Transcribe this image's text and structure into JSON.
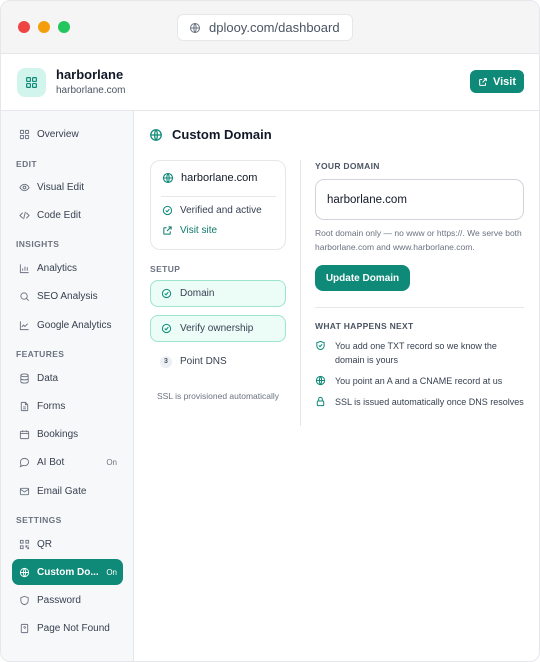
{
  "browser": {
    "url": "dplooy.com/dashboard"
  },
  "site": {
    "name": "harborlane",
    "domain": "harborlane.com",
    "visit_label": "Visit"
  },
  "sidebar": {
    "overview": "Overview",
    "sections": {
      "edit": "EDIT",
      "insights": "INSIGHTS",
      "features": "FEATURES",
      "settings": "SETTINGS"
    },
    "items": {
      "visual_edit": "Visual Edit",
      "code_edit": "Code Edit",
      "analytics": "Analytics",
      "seo_analysis": "SEO Analysis",
      "google_analytics": "Google Analytics",
      "data": "Data",
      "forms": "Forms",
      "bookings": "Bookings",
      "ai_bot": "AI Bot",
      "ai_bot_tag": "On",
      "email_gate": "Email Gate",
      "qr": "QR",
      "custom_domain": "Custom Do...",
      "custom_domain_tag": "On",
      "password": "Password",
      "page_not_found": "Page Not Found"
    }
  },
  "main": {
    "title": "Custom Domain",
    "card": {
      "domain": "harborlane.com",
      "status": "Verified and active",
      "visit_link": "Visit site"
    },
    "setup": {
      "label": "SETUP",
      "steps": [
        {
          "label": "Domain",
          "state": "done"
        },
        {
          "label": "Verify ownership",
          "state": "done"
        },
        {
          "label": "Point DNS",
          "state": "pending",
          "number": "3"
        }
      ],
      "ssl_note": "SSL is provisioned automatically"
    },
    "your_domain": {
      "label": "YOUR DOMAIN",
      "value": "harborlane.com",
      "hint": "Root domain only — no www or https://. We serve both harborlane.com and www.harborlane.com.",
      "button": "Update Domain"
    },
    "next": {
      "label": "WHAT HAPPENS NEXT",
      "items": [
        {
          "icon": "shield-check-icon",
          "text": "You add one TXT record so we know the domain is yours"
        },
        {
          "icon": "globe-icon",
          "text": "You point an A and a CNAME record at us"
        },
        {
          "icon": "lock-icon",
          "text": "SSL is issued automatically once DNS resolves"
        }
      ]
    }
  },
  "colors": {
    "accent": "#0f8a78",
    "accent_light": "#ecfdf8",
    "accent_border": "#9fe3d1"
  }
}
